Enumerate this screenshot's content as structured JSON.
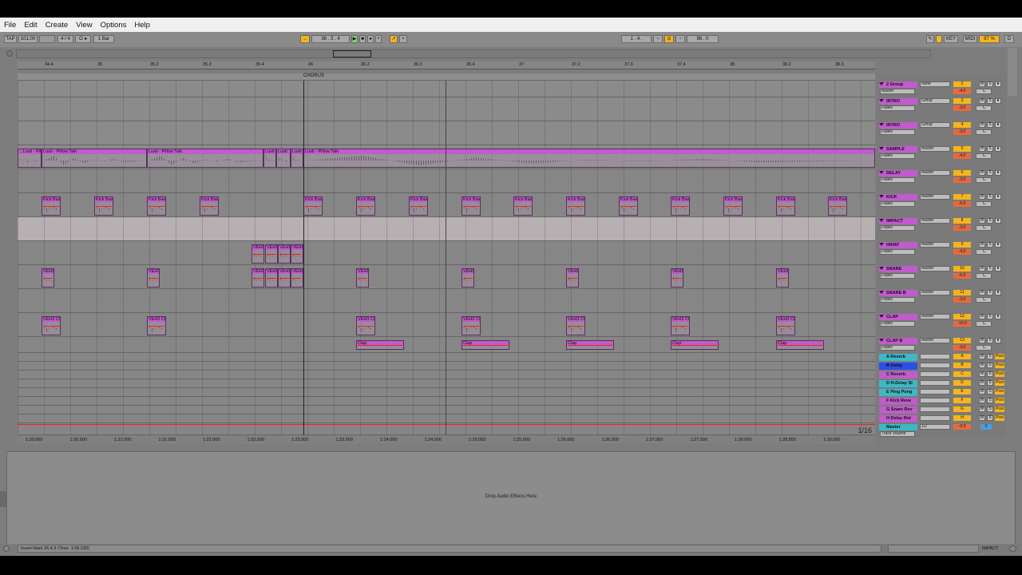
{
  "menu": {
    "file": "File",
    "edit": "Edit",
    "create": "Create",
    "view": "View",
    "options": "Options",
    "help": "Help"
  },
  "control": {
    "tap": "TAP",
    "tempo": "101.00",
    "sig": "4 / 4",
    "metro": "O ●",
    "quant": "1 Bar",
    "position": "36 . 3 . 4",
    "loop_start": "1 . 4 .",
    "loop_len": "96 . 0",
    "key": "KEY",
    "midi": "MIDI",
    "cpu": "97 %",
    "disk": "D"
  },
  "locator": {
    "chorus": "CHORUS"
  },
  "ruler_bars": [
    "34.4",
    "35",
    "35.2",
    "35.3",
    "35.4",
    "36",
    "36.2",
    "36.3",
    "36.4",
    "37",
    "37.2",
    "37.3",
    "37.4",
    "38",
    "38.2",
    "38.3"
  ],
  "time_ticks": [
    "1:20.000",
    "1:20.500",
    "1:21.000",
    "1:21.500",
    "1:22.000",
    "1:22.500",
    "1:23.000",
    "1:23.500",
    "1:24.000",
    "1:24.500",
    "1:25.000",
    "1:25.500",
    "1:26.000",
    "1:26.500",
    "1:27.000",
    "1:27.500",
    "1:28.000",
    "1:28.500",
    "1:29.000"
  ],
  "zoom": "1/16",
  "tracks": [
    {
      "name": "2 Group",
      "color": "#c05ccc",
      "route1": "Master",
      "route2": "None",
      "num": "2",
      "vol": "-4.0",
      "pan": "C"
    },
    {
      "name": "INTRO",
      "color": "#c05ccc",
      "route1": "Fades",
      "route2": "Group",
      "num": "3",
      "vol": "-3.0",
      "pan": "C"
    },
    {
      "name": "INTRO",
      "color": "#c05ccc",
      "route1": "Fades",
      "route2": "Group",
      "num": "4",
      "vol": "-3.0",
      "pan": "C"
    },
    {
      "name": "SAMPLE",
      "color": "#c05ccc",
      "route1": "Fades",
      "route2": "Master",
      "num": "5",
      "vol": "-4.0",
      "pan": "C"
    },
    {
      "name": "DELAY",
      "color": "#c05ccc",
      "route1": "Fades",
      "route2": "Master",
      "num": "6",
      "vol": "-3.0",
      "pan": "C"
    },
    {
      "name": "KICK",
      "color": "#c05ccc",
      "route1": "Fades",
      "route2": "Master",
      "num": "7",
      "vol": "-5.0",
      "pan": "C"
    },
    {
      "name": "IMPACT",
      "color": "#c05ccc",
      "route1": "Fades",
      "route2": "Master",
      "num": "8",
      "vol": "-3.0",
      "pan": "C"
    },
    {
      "name": "HIHAT",
      "color": "#c05ccc",
      "route1": "Fades",
      "route2": "Master",
      "num": "9",
      "vol": "-4.5",
      "pan": "C"
    },
    {
      "name": "SNARE",
      "color": "#c05ccc",
      "route1": "Fades",
      "route2": "Master",
      "num": "10",
      "vol": "-6.0",
      "pan": "C"
    },
    {
      "name": "SNARE B",
      "color": "#c05ccc",
      "route1": "Fades",
      "route2": "Master",
      "num": "11",
      "vol": "-3.0",
      "pan": "C"
    },
    {
      "name": "CLAP",
      "color": "#c05ccc",
      "route1": "Fades",
      "route2": "Master",
      "num": "12",
      "vol": "-10.0",
      "pan": "C"
    },
    {
      "name": "CLAP B",
      "color": "#c05ccc",
      "route1": "Fades",
      "route2": "Master",
      "num": "13",
      "vol": "-3.0",
      "pan": "C"
    }
  ],
  "returns": [
    {
      "name": "A Reverb",
      "color": "#3db8c5",
      "letter": "A"
    },
    {
      "name": "B Delay",
      "color": "#2b4fe6",
      "letter": "B"
    },
    {
      "name": "C Reverb",
      "color": "#c05ccc",
      "letter": "C"
    },
    {
      "name": "D H-Delay St",
      "color": "#3db8c5",
      "letter": "D"
    },
    {
      "name": "E Ping Pong",
      "color": "#3db8c5",
      "letter": "E"
    },
    {
      "name": "F Kick Reve",
      "color": "#c05ccc",
      "letter": "F"
    },
    {
      "name": "G Snare Rev",
      "color": "#c05ccc",
      "letter": "G"
    },
    {
      "name": "H Delay Rot",
      "color": "#c05ccc",
      "letter": "H"
    }
  ],
  "master": {
    "name": "Master",
    "route": "1/2",
    "track_volume": "Track Volume",
    "vol": "-3.3",
    "num": "0"
  },
  "clips": {
    "sample_a": "...Lusti - Pil",
    "sample_b": "Lusti - Pillow Talk",
    "sample_c": "Lusti - Pillow Talk",
    "sample_d": "Lusti",
    "sample_e": "Lusti",
    "sample_f": "Lusti",
    "sample_g": "Lusti - Pillow Talk",
    "kick": "Kick Bas",
    "veh": "VEH1",
    "vehc": "VEH3 Cl",
    "clap": "Clap"
  },
  "device": {
    "drop": "Drop Audio Effects Here"
  },
  "status": {
    "text": "Insert Mark 36.4.3 (Time: 1:06:230)",
    "right": "IMPACT"
  }
}
